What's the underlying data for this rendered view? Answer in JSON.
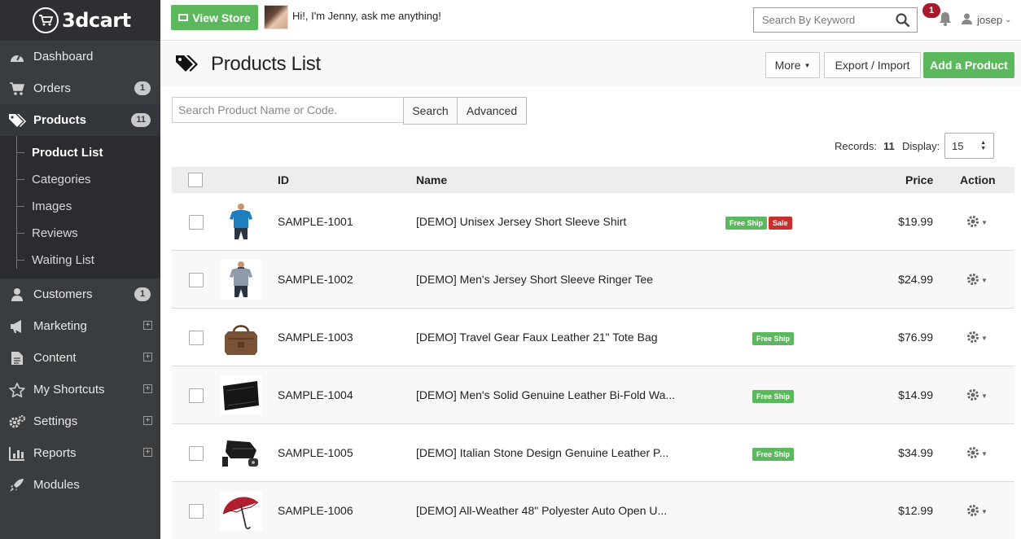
{
  "sidebar": {
    "logo": "3dcart",
    "items": [
      {
        "label": "Dashboard",
        "icon": "dashboard-icon"
      },
      {
        "label": "Orders",
        "icon": "cart-icon",
        "badge": "1"
      },
      {
        "label": "Products",
        "icon": "tags-icon",
        "badge": "11"
      },
      {
        "label": "Customers",
        "icon": "user-icon",
        "badge": "1"
      },
      {
        "label": "Marketing",
        "icon": "bullhorn-icon"
      },
      {
        "label": "Content",
        "icon": "file-icon"
      },
      {
        "label": "My Shortcuts",
        "icon": "star-icon"
      },
      {
        "label": "Settings",
        "icon": "gears-icon"
      },
      {
        "label": "Reports",
        "icon": "bar-chart-icon"
      },
      {
        "label": "Modules",
        "icon": "rocket-icon"
      }
    ],
    "subitems": [
      "Product List",
      "Categories",
      "Images",
      "Reviews",
      "Waiting List"
    ]
  },
  "topbar": {
    "view_store": "View Store",
    "assistant": "Hi!, I'm Jenny, ask me anything!",
    "search_placeholder": "Search By Keyword",
    "notif_count": "1",
    "user": "josep"
  },
  "header": {
    "title": "Products List",
    "more": "More",
    "export": "Export / Import",
    "add": "Add a Product"
  },
  "search": {
    "placeholder": "Search Product Name or Code.",
    "search_btn": "Search",
    "advanced_btn": "Advanced"
  },
  "records": {
    "label": "Records:",
    "count": "11",
    "display_label": "Display:",
    "display_value": "15"
  },
  "table": {
    "headers": {
      "id": "ID",
      "name": "Name",
      "price": "Price",
      "action": "Action"
    },
    "rows": [
      {
        "id": "SAMPLE-1001",
        "name": "[DEMO] Unisex Jersey Short Sleeve Shirt",
        "price": "$19.99",
        "tags": [
          "Free Ship",
          "Sale"
        ],
        "thumb": "blue-shirt"
      },
      {
        "id": "SAMPLE-1002",
        "name": "[DEMO] Men's Jersey Short Sleeve Ringer Tee",
        "price": "$24.99",
        "tags": [],
        "thumb": "grey-tee"
      },
      {
        "id": "SAMPLE-1003",
        "name": "[DEMO] Travel Gear Faux Leather 21\" Tote Bag",
        "price": "$76.99",
        "tags": [
          "Free Ship"
        ],
        "thumb": "tote-bag"
      },
      {
        "id": "SAMPLE-1004",
        "name": "[DEMO] Men's Solid Genuine Leather Bi-Fold Wa...",
        "price": "$14.99",
        "tags": [
          "Free Ship"
        ],
        "thumb": "wallet"
      },
      {
        "id": "SAMPLE-1005",
        "name": "[DEMO] Italian Stone Design Genuine Leather P...",
        "price": "$34.99",
        "tags": [
          "Free Ship"
        ],
        "thumb": "accessories"
      },
      {
        "id": "SAMPLE-1006",
        "name": "[DEMO] All-Weather 48\" Polyester Auto Open U...",
        "price": "$12.99",
        "tags": [],
        "thumb": "umbrella"
      }
    ]
  },
  "colors": {
    "sidebar": "#3a3d40",
    "green": "#5cb85c",
    "red": "#c9302c",
    "badge": "#a8192e"
  }
}
